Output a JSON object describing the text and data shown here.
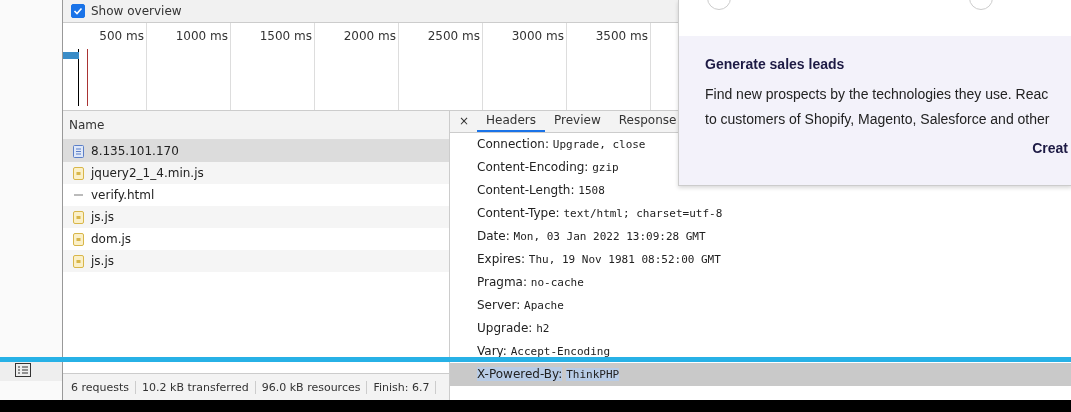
{
  "overview": {
    "label": "Show overview",
    "checked": true
  },
  "timeline": {
    "ticks": [
      "500 ms",
      "1000 ms",
      "1500 ms",
      "2000 ms",
      "2500 ms",
      "3000 ms",
      "3500 ms"
    ]
  },
  "requests": {
    "column": "Name",
    "rows": [
      {
        "name": "8.135.101.170",
        "kind": "document",
        "selected": true
      },
      {
        "name": "jquery2_1_4.min.js",
        "kind": "script",
        "selected": false
      },
      {
        "name": "verify.html",
        "kind": "other",
        "selected": false
      },
      {
        "name": "js.js",
        "kind": "script",
        "selected": false
      },
      {
        "name": "dom.js",
        "kind": "script",
        "selected": false
      },
      {
        "name": "js.js",
        "kind": "script",
        "selected": false
      }
    ]
  },
  "details": {
    "close": "×",
    "tabs": [
      {
        "label": "Headers",
        "selected": true
      },
      {
        "label": "Preview",
        "selected": false
      },
      {
        "label": "Response",
        "selected": false
      }
    ],
    "headers": [
      {
        "name": "Connection:",
        "value": "Upgrade, close",
        "selected": false
      },
      {
        "name": "Content-Encoding:",
        "value": "gzip",
        "selected": false
      },
      {
        "name": "Content-Length:",
        "value": "1508",
        "selected": false
      },
      {
        "name": "Content-Type:",
        "value": "text/html; charset=utf-8",
        "selected": false
      },
      {
        "name": "Date:",
        "value": "Mon, 03 Jan 2022 13:09:28 GMT",
        "selected": false
      },
      {
        "name": "Expires:",
        "value": "Thu, 19 Nov 1981 08:52:00 GMT",
        "selected": false
      },
      {
        "name": "Pragma:",
        "value": "no-cache",
        "selected": false
      },
      {
        "name": "Server:",
        "value": "Apache",
        "selected": false
      },
      {
        "name": "Upgrade:",
        "value": "h2",
        "selected": false
      },
      {
        "name": "Vary:",
        "value": "Accept-Encoding",
        "selected": false
      },
      {
        "name": "X-Powered-By:",
        "value": "ThinkPHP",
        "selected": true
      }
    ]
  },
  "status_bar": [
    "6 requests",
    "10.2 kB transferred",
    "96.0 kB resources",
    "Finish: 6.7"
  ],
  "popup": {
    "title": "Generate sales leads",
    "lines": [
      "Find new prospects by the technologies they use. Reac",
      "to customers of Shopify, Magento, Salesforce and other"
    ],
    "link": "Creat"
  }
}
